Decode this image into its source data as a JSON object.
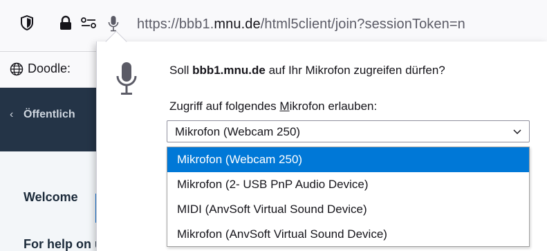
{
  "urlbar": {
    "url_prefix": "https://bbb1.",
    "url_domain": "mnu.de",
    "url_suffix": "/html5client/join?sessionToken=n",
    "icons": [
      "shield-icon",
      "lock-icon",
      "permissions-icon",
      "microphone-icon"
    ]
  },
  "bookmarks": {
    "items": [
      {
        "label": "Doodle:",
        "icon": "globe-icon"
      }
    ]
  },
  "page": {
    "back_label": "Öffentlich",
    "welcome_text": "Welcome",
    "help_text": "For help on using BigBlueButton see these"
  },
  "popup": {
    "question_prefix": "Soll ",
    "question_site": "bbb1.mnu.de",
    "question_suffix": " auf Ihr Mikrofon zugreifen dürfen?",
    "allow_label_prefix": "Zugriff auf folgendes ",
    "allow_label_accel": "M",
    "allow_label_suffix": "ikrofon erlauben:",
    "selected_value": "Mikrofon (Webcam 250)",
    "options": [
      {
        "label": "Mikrofon (Webcam 250)",
        "selected": true
      },
      {
        "label": "Mikrofon (2- USB PnP Audio Device)",
        "selected": false
      },
      {
        "label": "MIDI (AnvSoft Virtual Sound Device)",
        "selected": false
      },
      {
        "label": "Mikrofon (AnvSoft Virtual Sound Device)",
        "selected": false
      }
    ]
  },
  "colors": {
    "selection": "#0078d7",
    "page_dark": "#243447",
    "accent_blue": "#0f70d7"
  }
}
